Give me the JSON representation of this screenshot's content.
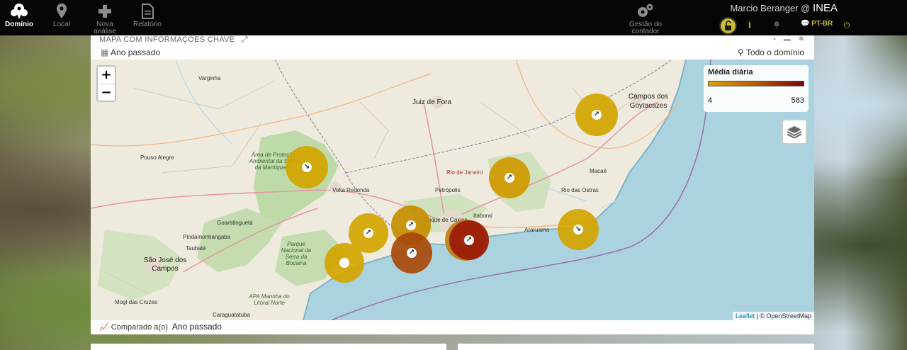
{
  "nav": {
    "items": [
      {
        "label": "Domínio",
        "icon": "cluster-pin-icon",
        "active": true
      },
      {
        "label": "Local",
        "icon": "map-pin-icon",
        "active": false
      },
      {
        "label": "Nova análise",
        "icon": "plus-icon",
        "active": false
      },
      {
        "label": "Relatório",
        "icon": "document-icon",
        "active": false
      }
    ],
    "gestao_label": "Gestão do contador",
    "user": "Marcio Beranger @",
    "org": "INEA",
    "lang": "PT-BR"
  },
  "panel": {
    "title": "MAPA COM INFORMAÇÕES CHAVE",
    "period": "Ano passado",
    "domain_filter": "Todo o domínio",
    "compare_label": "Comparado a(o)",
    "compare_value": "Ano passado"
  },
  "map": {
    "zoom_in": "+",
    "zoom_out": "−",
    "legend": {
      "title": "Média diária",
      "min": "4",
      "max": "583"
    },
    "attribution_leaflet": "Leaflet",
    "attribution_osm": "| © OpenStreetMap",
    "labels": {
      "varginha": "Varginha",
      "juiz_de_fora": "Juiz de Fora",
      "campos": "Campos dos Goytacazes",
      "pouso_alegre": "Pouso Alegre",
      "volta_redonda": "Volta Redonda",
      "rio": "Rio de Janeiro",
      "petropolis": "Petrópolis",
      "macae": "Macaé",
      "rio_das_ostras": "Rio das Ostras",
      "guaratingueta": "Guaratinguetá",
      "pindamonhangaba": "Pindamonhangaba",
      "taubate": "Taubaté",
      "sjc": "São José dos Campos",
      "araruama": "Araruama",
      "itaborai": "Itaboraí",
      "caxias": "Duque de Caxias",
      "mogi": "Mogi das Cruzes",
      "caraguatatuba": "Caraguatatuba",
      "apa_mantiqueira": "Área de Proteção Ambiental da Serra da Mantiqueira",
      "pn_bocaina": "Parque Nacional da Serra da Bocaina",
      "apa_litoral": "APA Marinha do Litoral Norte"
    },
    "markers": [
      {
        "color": "#d4a500",
        "level": "low",
        "arrow": "↘"
      },
      {
        "color": "#d4a500",
        "level": "low",
        "arrow": "↗"
      },
      {
        "color": "#cf9a00",
        "level": "low",
        "arrow": "↗"
      },
      {
        "color": "#c78e00",
        "level": "low",
        "arrow": "↗"
      },
      {
        "color": "#d4a500",
        "level": "low",
        "arrow": "↘"
      },
      {
        "color": "#d4a500",
        "level": "low",
        "arrow": ""
      },
      {
        "color": "#d4a500",
        "level": "low",
        "arrow": "↗"
      },
      {
        "color": "#c0800a",
        "level": "medium",
        "arrow": "↗"
      },
      {
        "color": "#a84a0a",
        "level": "high",
        "arrow": "↗"
      },
      {
        "color": "#9a1a06",
        "level": "max",
        "arrow": "↗"
      }
    ]
  }
}
